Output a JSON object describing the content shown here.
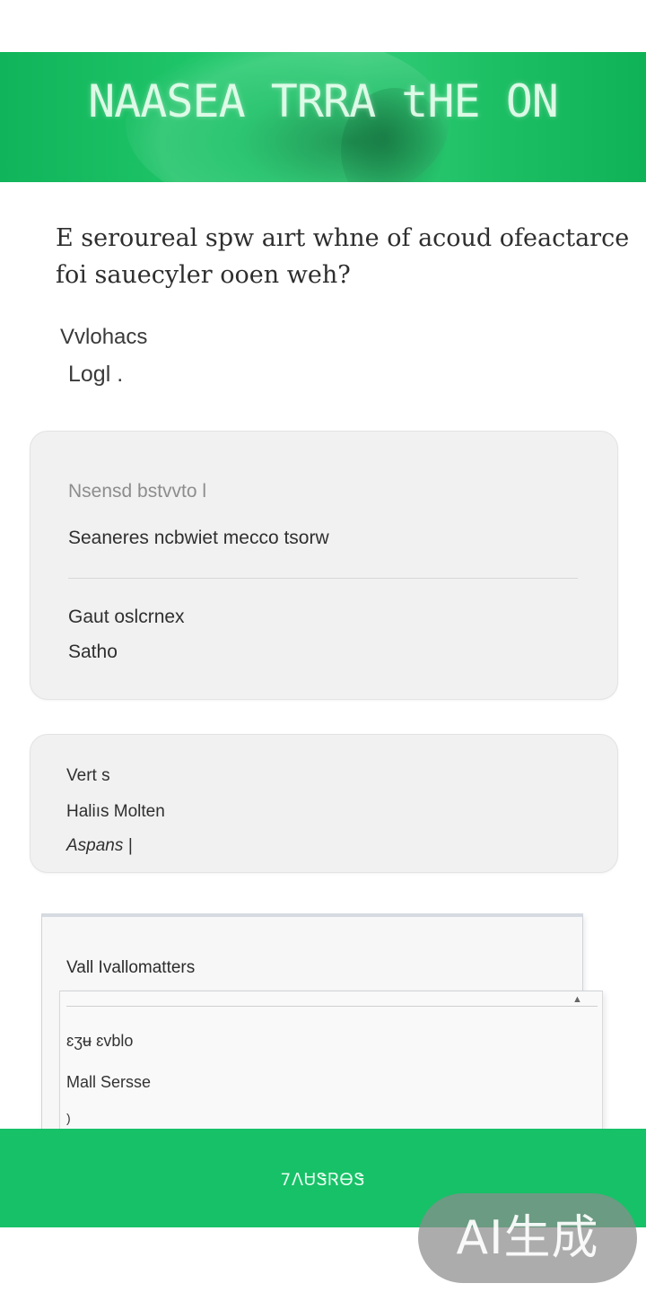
{
  "header": {
    "banner_title": "NAASEA TRRA tHE ON"
  },
  "question": {
    "text": "E seroureal spw aırt whne of acoud ofeactarce foi sauecyler ooen weh?"
  },
  "meta": {
    "label": "Vvlohacs",
    "value": "Logl ."
  },
  "card1": {
    "caption": "Nsensd  bstvvto l",
    "primary": "Seaneres ncbwiet mecco tsorw",
    "field_label": "Gaut oslcrnex",
    "field_value": "Satho"
  },
  "card2": {
    "line1": "Vert s",
    "line2": "Haliıs Molten",
    "line3": "Aspans |"
  },
  "panel": {
    "header": "Vall Ivallomatters",
    "rows": [
      "ɛʒʉ ɛvblo",
      "Mall Sersse",
      ")"
    ]
  },
  "bottom_bar": {
    "label": "7ᐱᏌᏕᏒᎾᏕ"
  },
  "watermark": {
    "text": "AI生成"
  },
  "colors": {
    "brand_green": "#17c168",
    "card_bg": "#f1f1f1"
  }
}
